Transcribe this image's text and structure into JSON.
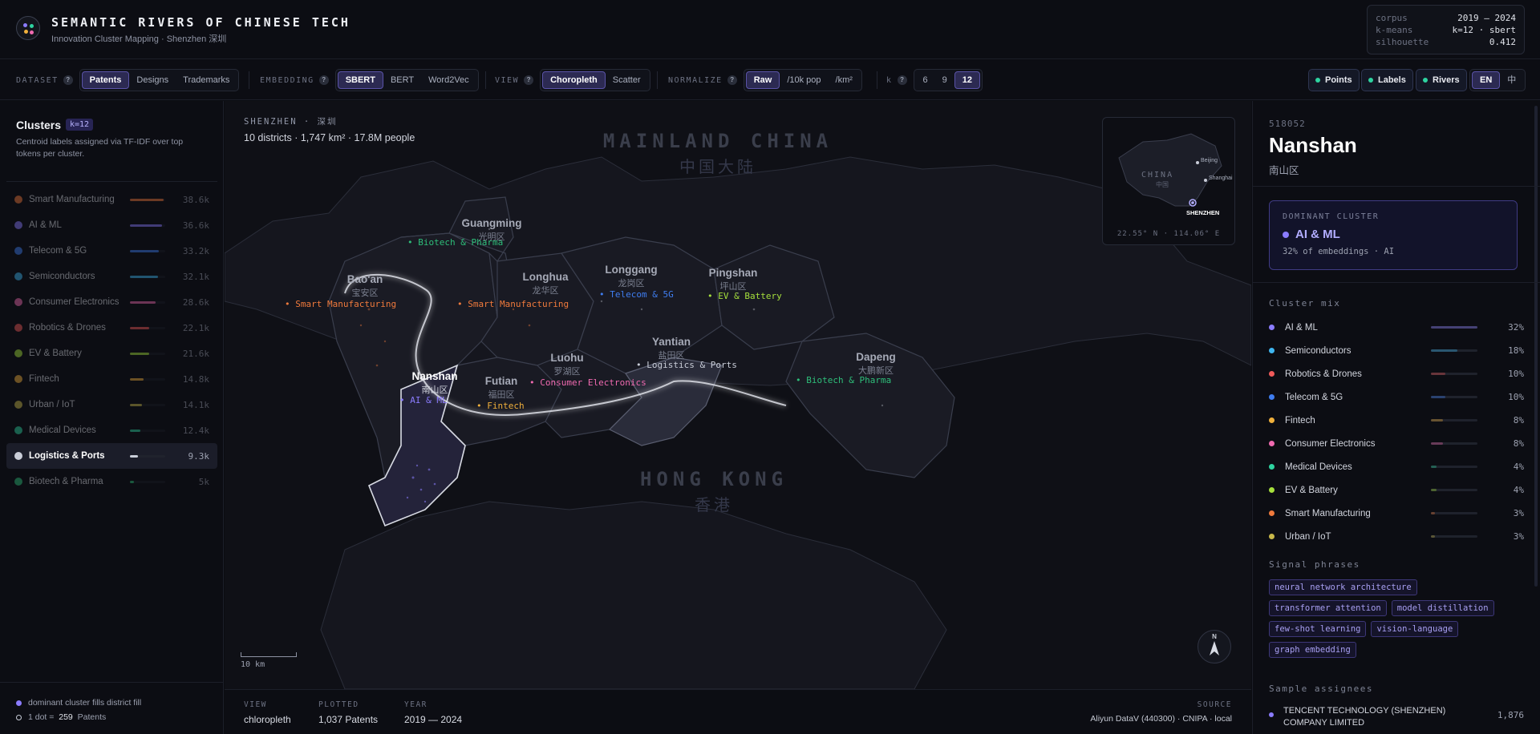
{
  "header": {
    "title": "SEMANTIC RIVERS OF CHINESE TECH",
    "subtitle": "Innovation Cluster Mapping · Shenzhen 深圳",
    "corpus": [
      {
        "k": "corpus",
        "v": "2019 — 2024"
      },
      {
        "k": "k-means",
        "v": "k=12 · sbert"
      },
      {
        "k": "silhouette",
        "v": "0.412"
      }
    ]
  },
  "toolbar": {
    "dataset": {
      "label": "DATASET",
      "options": [
        "Patents",
        "Designs",
        "Trademarks"
      ],
      "selected": "Patents"
    },
    "embedding": {
      "label": "EMBEDDING",
      "options": [
        "SBERT",
        "BERT",
        "Word2Vec"
      ],
      "selected": "SBERT"
    },
    "view": {
      "label": "VIEW",
      "options": [
        "Choropleth",
        "Scatter"
      ],
      "selected": "Choropleth"
    },
    "normalize": {
      "label": "NORMALIZE",
      "options": [
        "Raw",
        "/10k pop",
        "/km²"
      ],
      "selected": "Raw"
    },
    "k": {
      "label": "k",
      "options": [
        "6",
        "9",
        "12"
      ],
      "selected": "12"
    },
    "qmark": "?",
    "toggles": [
      "Points",
      "Labels",
      "Rivers"
    ],
    "lang": {
      "options": [
        "EN",
        "中"
      ],
      "selected": "EN"
    }
  },
  "clusters_panel": {
    "title": "Clusters",
    "badge": "k=12",
    "description": "Centroid labels assigned via TF-IDF over top tokens per cluster.",
    "items": [
      {
        "name": "Smart Manufacturing",
        "value": "38.6k",
        "color": "#f07a3c",
        "share": 0.95
      },
      {
        "name": "AI & ML",
        "value": "36.6k",
        "color": "#8b7cff",
        "share": 0.9
      },
      {
        "name": "Telecom & 5G",
        "value": "33.2k",
        "color": "#3f7df0",
        "share": 0.82
      },
      {
        "name": "Semiconductors",
        "value": "32.1k",
        "color": "#3fb6f0",
        "share": 0.8
      },
      {
        "name": "Consumer Electronics",
        "value": "28.6k",
        "color": "#f06ab0",
        "share": 0.72
      },
      {
        "name": "Robotics & Drones",
        "value": "22.1k",
        "color": "#f05a5a",
        "share": 0.55
      },
      {
        "name": "EV & Battery",
        "value": "21.6k",
        "color": "#a6e03c",
        "share": 0.54
      },
      {
        "name": "Fintech",
        "value": "14.8k",
        "color": "#f0b03c",
        "share": 0.38
      },
      {
        "name": "Urban / IoT",
        "value": "14.1k",
        "color": "#c8b84a",
        "share": 0.35
      },
      {
        "name": "Medical Devices",
        "value": "12.4k",
        "color": "#2ed3a0",
        "share": 0.3
      },
      {
        "name": "Logistics & Ports",
        "value": "9.3k",
        "color": "#c9cdd8",
        "share": 0.23,
        "selected": true
      },
      {
        "name": "Biotech & Pharma",
        "value": "5k",
        "color": "#2ebf7a",
        "share": 0.12
      }
    ],
    "legend": {
      "fill_text": "dominant cluster fills district fill",
      "dot_text": "1 dot =",
      "dot_value": "259",
      "dot_unit": "Patents"
    }
  },
  "map": {
    "header_title": "SHENZHEN · 深圳",
    "header_stats": "10 districts · 1,747 km² · 17.8M people",
    "mainland": {
      "en": "MAINLAND CHINA",
      "cn": "中国大陆"
    },
    "hongkong": {
      "en": "HONG KONG",
      "cn": "香港"
    },
    "districts": [
      {
        "name": "Guangming",
        "cn": "光明区",
        "label": "Biotech & Pharma",
        "color": "#2ebf7a"
      },
      {
        "name": "Bao'an",
        "cn": "宝安区",
        "label": "Smart Manufacturing",
        "color": "#f07a3c"
      },
      {
        "name": "Longhua",
        "cn": "龙华区",
        "label": "Smart Manufacturing",
        "color": "#f07a3c"
      },
      {
        "name": "Longgang",
        "cn": "龙岗区",
        "label": "Telecom & 5G",
        "color": "#3f7df0"
      },
      {
        "name": "Pingshan",
        "cn": "坪山区",
        "label": "EV & Battery",
        "color": "#a6e03c"
      },
      {
        "name": "Yantian",
        "cn": "盐田区",
        "label": "Logistics & Ports",
        "color": "#c9cdd8"
      },
      {
        "name": "Luohu",
        "cn": "罗湖区",
        "label": "Consumer Electronics",
        "color": "#f06ab0"
      },
      {
        "name": "Futian",
        "cn": "福田区",
        "label": "Fintech",
        "color": "#f0b03c"
      },
      {
        "name": "Nanshan",
        "cn": "南山区",
        "label": "AI & ML",
        "color": "#8b7cff",
        "selected": true
      },
      {
        "name": "Dapeng",
        "cn": "大鹏新区",
        "label": "Biotech & Pharma",
        "color": "#2ebf7a"
      }
    ],
    "inset": {
      "country": "CHINA",
      "country_cn": "中国",
      "cities": [
        "Beijing",
        "Shanghai",
        "SHENZHEN"
      ],
      "coords": "22.55° N · 114.06° E"
    },
    "scale": "10 km",
    "compass": "N"
  },
  "bottom": {
    "view": {
      "k": "VIEW",
      "v": "chloropleth"
    },
    "plotted": {
      "k": "PLOTTED",
      "v": "1,037 Patents"
    },
    "year": {
      "k": "YEAR",
      "v": "2019 — 2024"
    },
    "source": {
      "k": "SOURCE",
      "v": "Aliyun DataV (440300) · CNIPA · local"
    }
  },
  "detail": {
    "code": "518052",
    "name": "Nanshan",
    "cn": "南山区",
    "dominant_label": "DOMINANT CLUSTER",
    "dominant_name": "AI & ML",
    "dominant_pct": "32% of embeddings · AI",
    "mix_title": "Cluster mix",
    "mix": [
      {
        "name": "AI & ML",
        "pct": "32%",
        "value": 0.32,
        "color": "#8b7cff"
      },
      {
        "name": "Semiconductors",
        "pct": "18%",
        "value": 0.18,
        "color": "#3fb6f0"
      },
      {
        "name": "Robotics & Drones",
        "pct": "10%",
        "value": 0.1,
        "color": "#f05a5a"
      },
      {
        "name": "Telecom & 5G",
        "pct": "10%",
        "value": 0.1,
        "color": "#3f7df0"
      },
      {
        "name": "Fintech",
        "pct": "8%",
        "value": 0.08,
        "color": "#f0b03c"
      },
      {
        "name": "Consumer Electronics",
        "pct": "8%",
        "value": 0.08,
        "color": "#f06ab0"
      },
      {
        "name": "Medical Devices",
        "pct": "4%",
        "value": 0.04,
        "color": "#2ed3a0"
      },
      {
        "name": "EV & Battery",
        "pct": "4%",
        "value": 0.04,
        "color": "#a6e03c"
      },
      {
        "name": "Smart Manufacturing",
        "pct": "3%",
        "value": 0.03,
        "color": "#f07a3c"
      },
      {
        "name": "Urban / IoT",
        "pct": "3%",
        "value": 0.03,
        "color": "#c8b84a"
      }
    ],
    "signal_title": "Signal phrases",
    "signals": [
      "neural network architecture",
      "transformer attention",
      "model distillation",
      "few-shot learning",
      "vision-language",
      "graph embedding"
    ],
    "assignees_title": "Sample assignees",
    "assignees": [
      {
        "name": "TENCENT TECHNOLOGY (SHENZHEN) COMPANY LIMITED",
        "value": "1,876"
      }
    ]
  }
}
